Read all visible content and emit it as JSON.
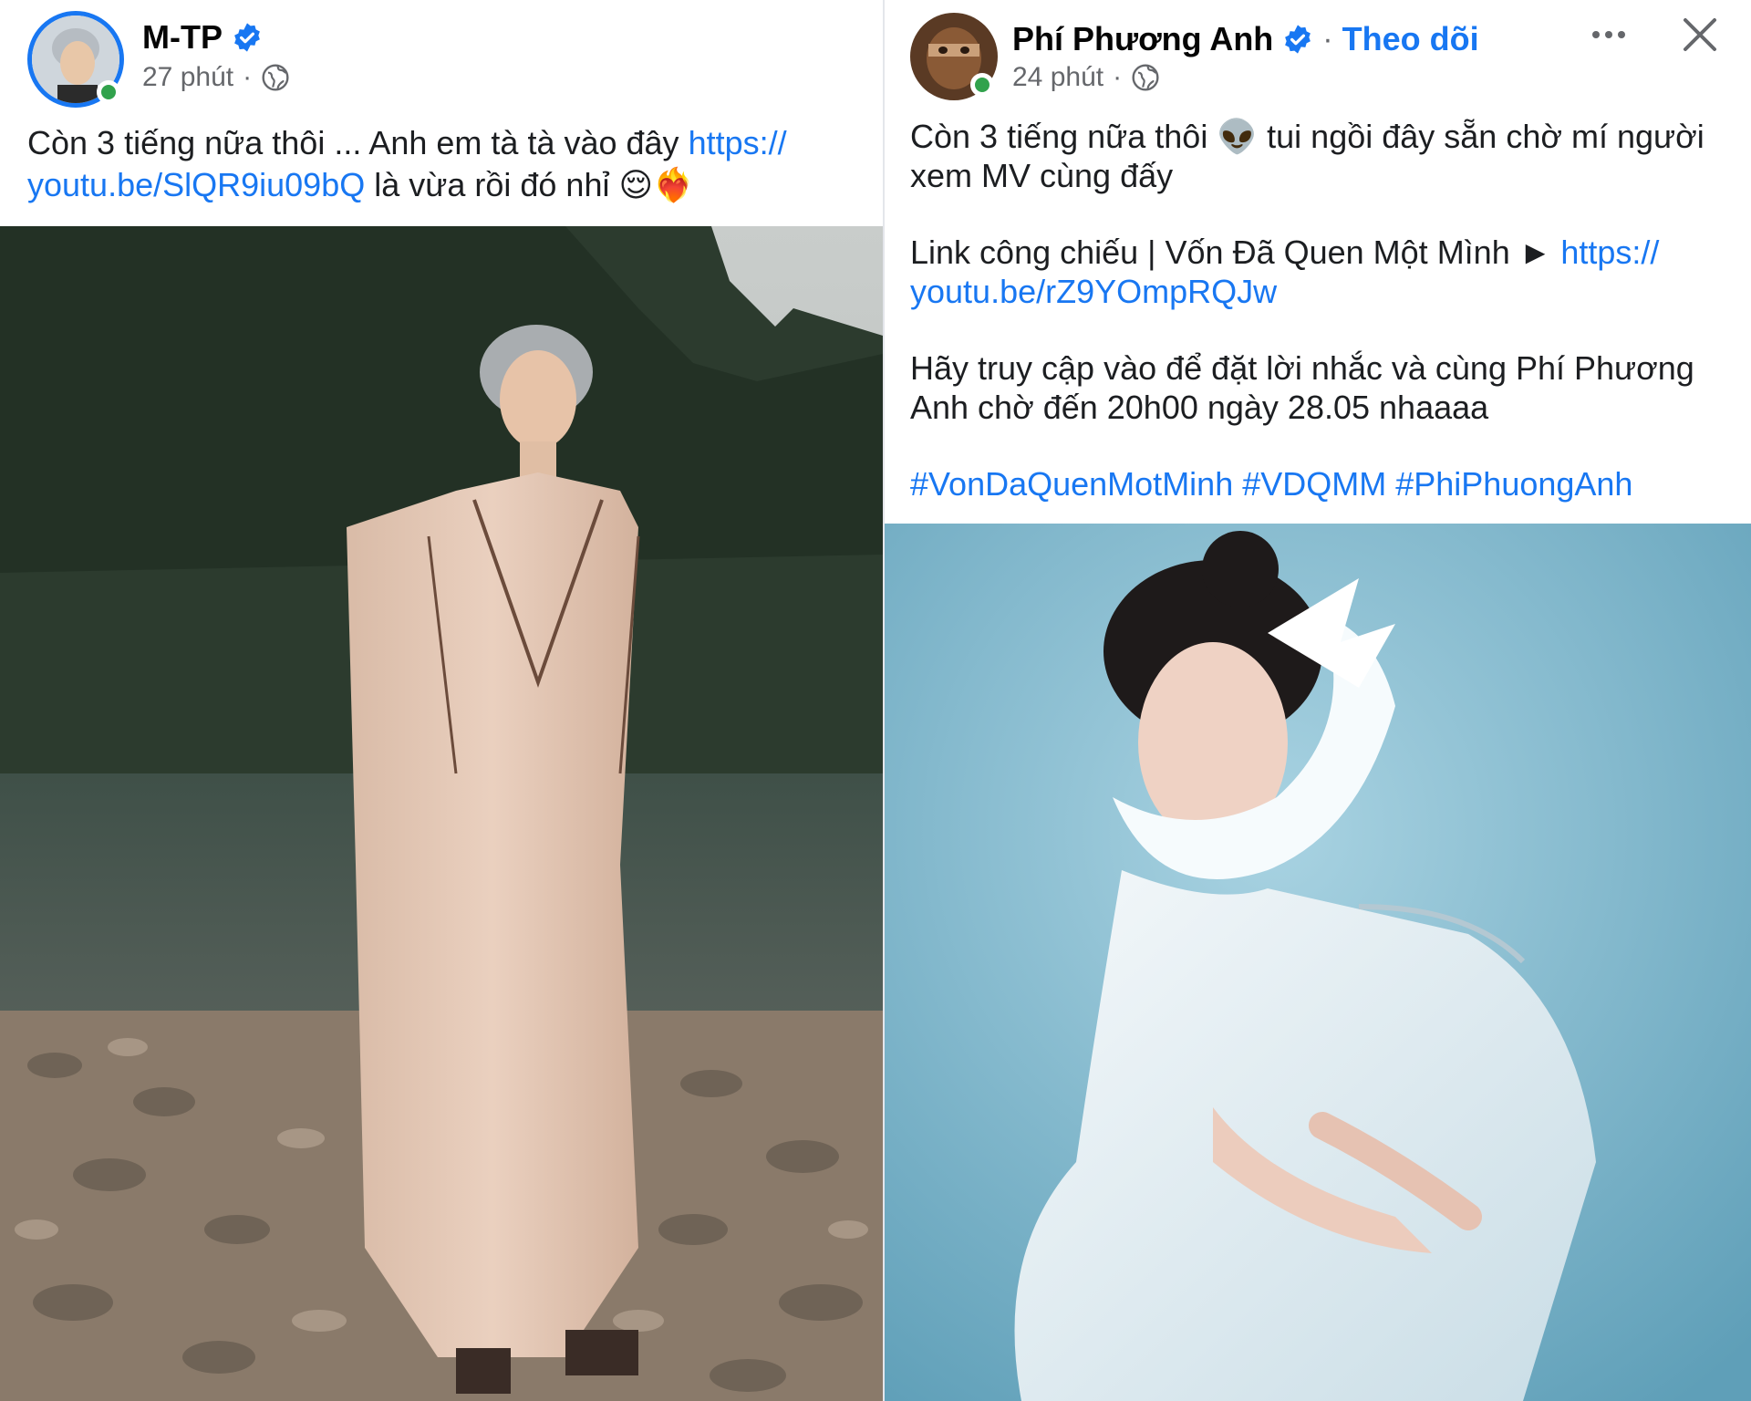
{
  "left_post": {
    "author": "M-TP",
    "time": "27 phút",
    "time_separator": "·",
    "text_before_link": "Còn 3 tiếng nữa thôi ... Anh em tà tà vào đây ",
    "link_part1": "https://",
    "link_part2": "youtu.be/SlQR9iu09bQ",
    "text_after_link": " là vừa rồi đó nhỉ 😌❤️‍🔥"
  },
  "right_post": {
    "author": "Phí Phương Anh",
    "follow_separator": "·",
    "follow_label": "Theo dõi",
    "time": "24 phút",
    "time_separator": "·",
    "line1": "Còn 3 tiếng nữa thôi 👽 tui ngồi đây sẵn chờ mí người",
    "line2": "xem MV cùng đấy",
    "link_label": "Link công chiếu | Vốn Đã Quen Một Mình ► ",
    "link_part1": "https://",
    "link_part2": "youtu.be/rZ9YOmpRQJw",
    "reminder_line1": "Hãy truy cập vào để đặt lời nhắc và cùng Phí Phương",
    "reminder_line2": "Anh chờ đến 20h00 ngày 28.05 nhaaaa",
    "hashtags": "#VonDaQuenMotMinh #VDQMM #PhiPhuongAnh"
  },
  "icons": {
    "verified": "verified-badge-icon",
    "globe": "globe-icon",
    "more": "more-options-icon",
    "close": "close-icon"
  },
  "colors": {
    "link": "#1877f2",
    "online": "#31a24c",
    "meta": "#65676b"
  }
}
